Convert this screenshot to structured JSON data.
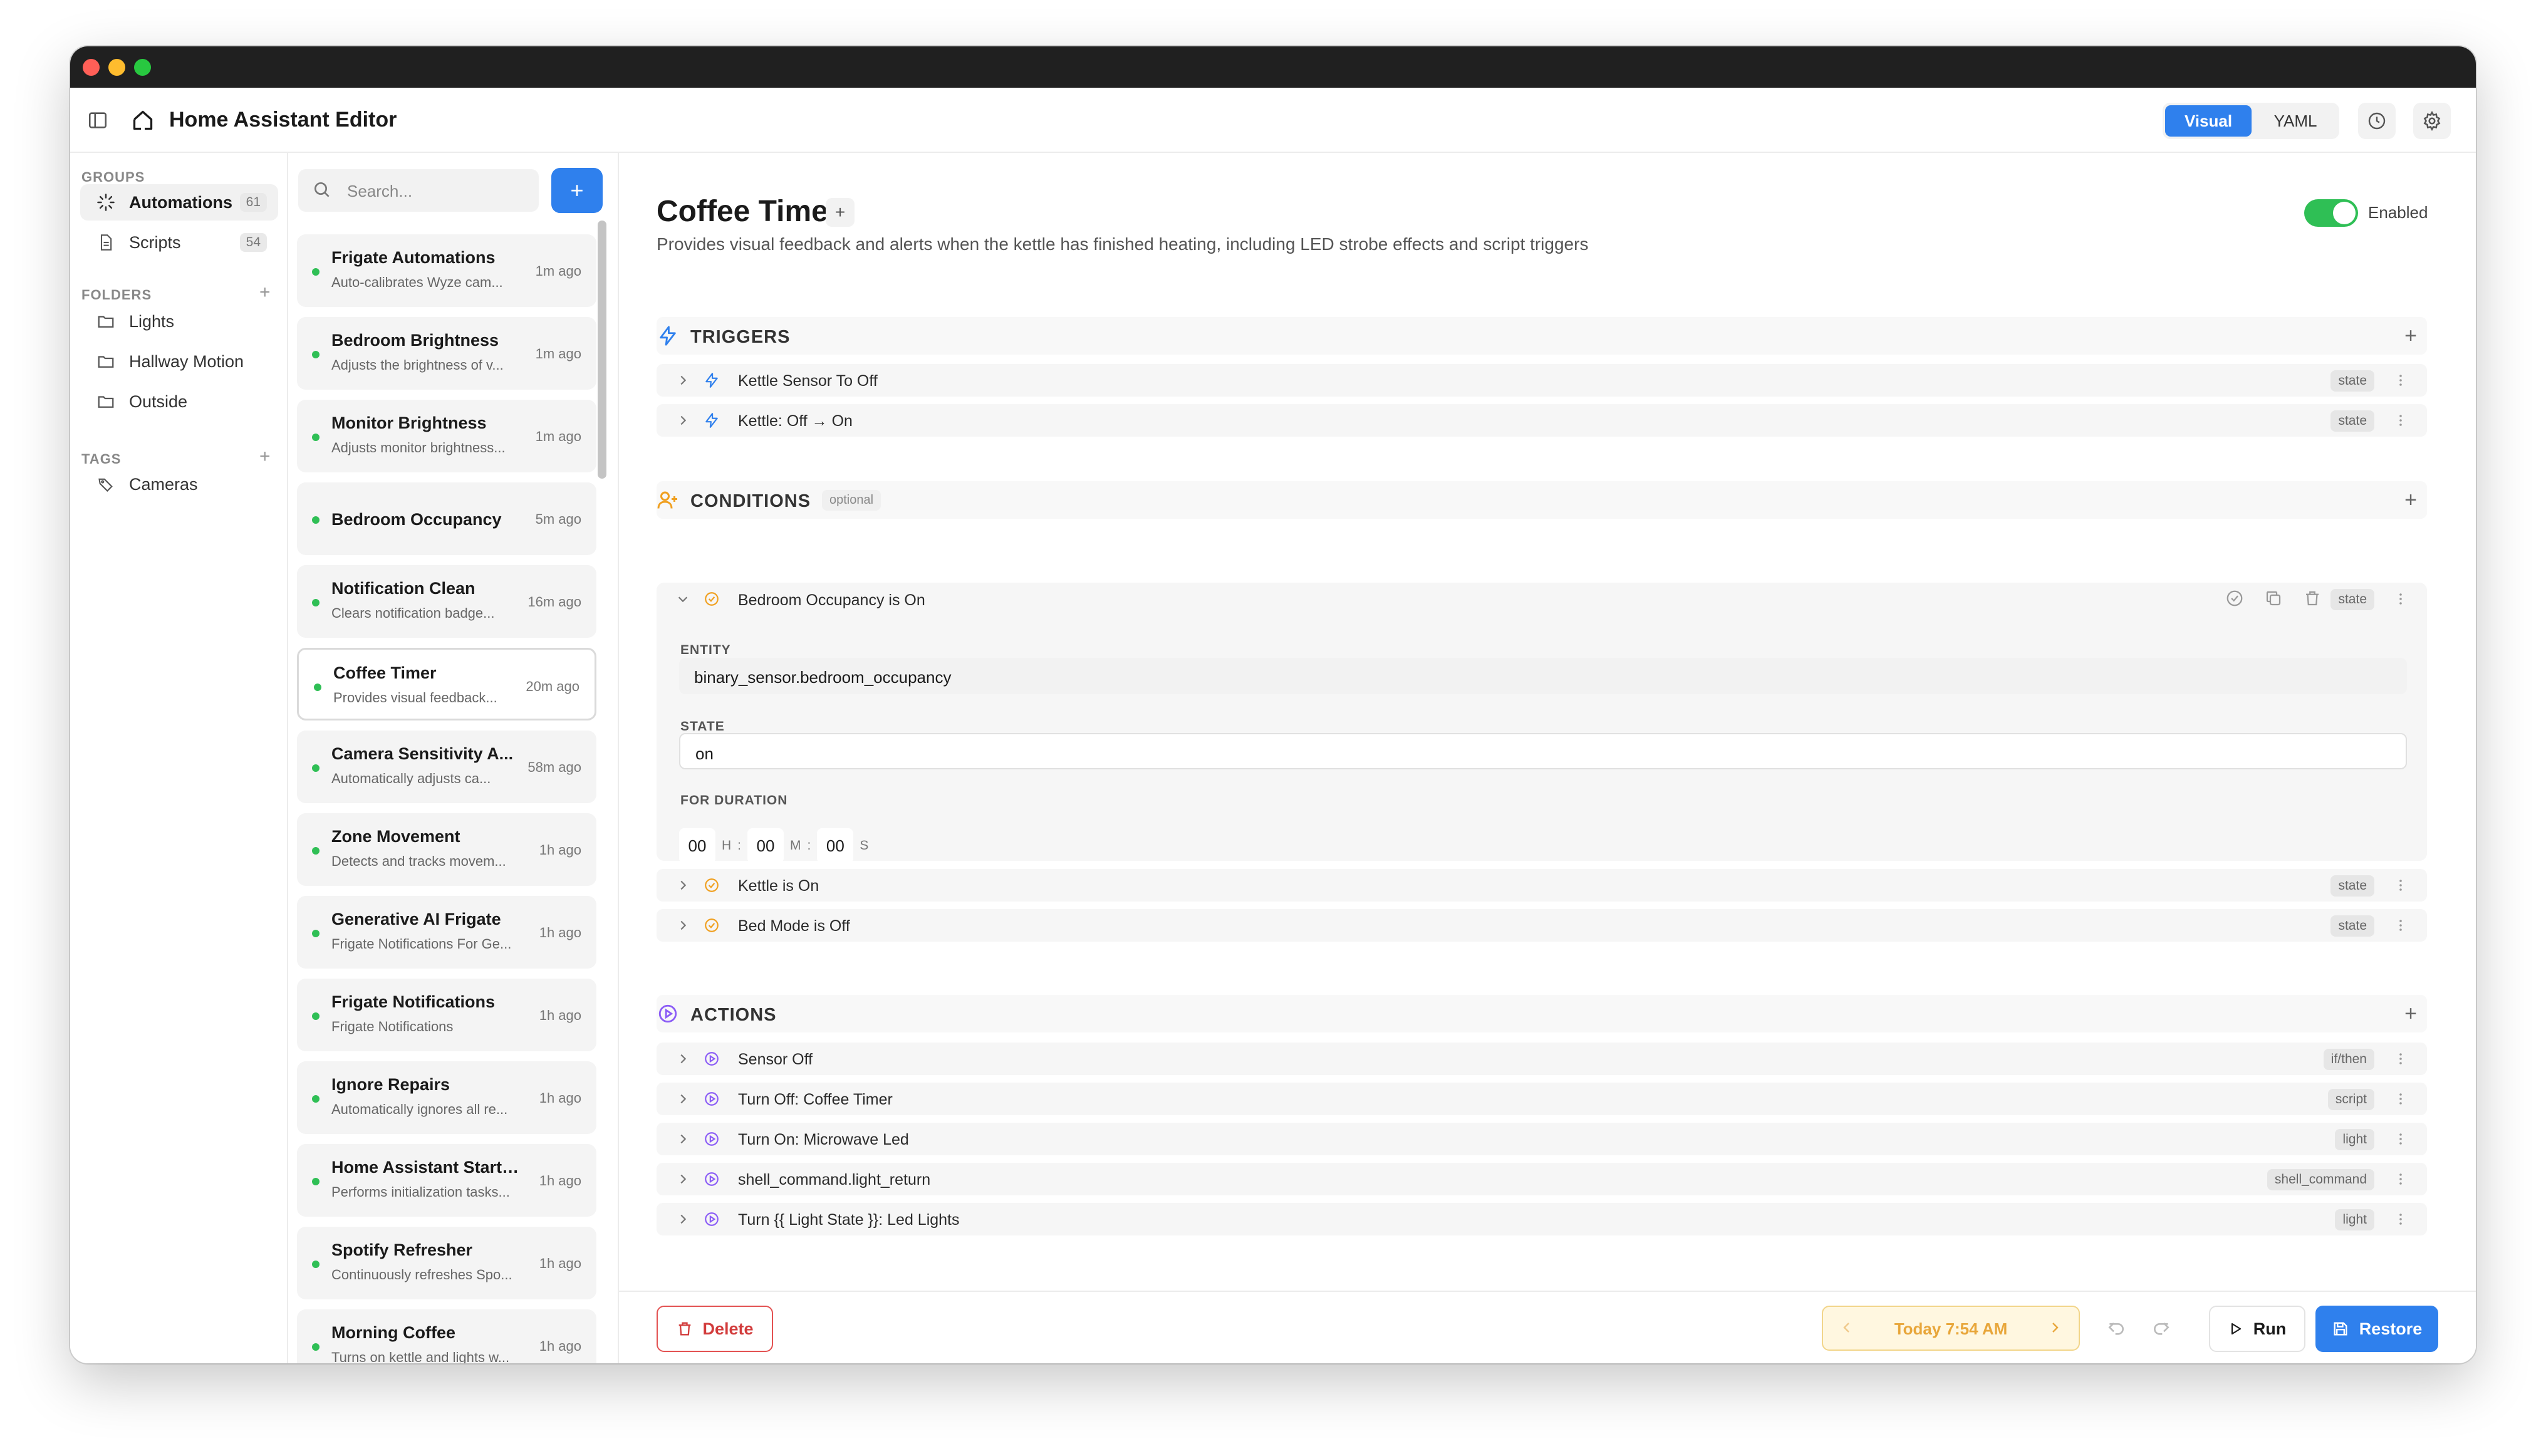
{
  "header": {
    "title": "Home Assistant Editor",
    "visual_label": "Visual",
    "yaml_label": "YAML"
  },
  "sidebar": {
    "groups_label": "GROUPS",
    "groups": [
      {
        "label": "Automations",
        "count": "61"
      },
      {
        "label": "Scripts",
        "count": "54"
      }
    ],
    "folders_label": "FOLDERS",
    "folders": [
      {
        "label": "Lights"
      },
      {
        "label": "Hallway Motion"
      },
      {
        "label": "Outside"
      }
    ],
    "tags_label": "TAGS",
    "tags": [
      {
        "label": "Cameras"
      }
    ]
  },
  "list": {
    "search_placeholder": "Search...",
    "items": [
      {
        "name": "Frigate Automations",
        "desc": "Auto-calibrates Wyze cam...",
        "time": "1m ago"
      },
      {
        "name": "Bedroom Brightness",
        "desc": "Adjusts the brightness of v...",
        "time": "1m ago"
      },
      {
        "name": "Monitor Brightness",
        "desc": "Adjusts monitor brightness...",
        "time": "1m ago"
      },
      {
        "name": "Bedroom Occupancy",
        "desc": "",
        "time": "5m ago"
      },
      {
        "name": "Notification Clean",
        "desc": "Clears notification badge...",
        "time": "16m ago"
      },
      {
        "name": "Coffee Timer",
        "desc": "Provides visual feedback...",
        "time": "20m ago"
      },
      {
        "name": "Camera Sensitivity A...",
        "desc": "Automatically adjusts ca...",
        "time": "58m ago"
      },
      {
        "name": "Zone Movement",
        "desc": "Detects and tracks movem...",
        "time": "1h ago"
      },
      {
        "name": "Generative AI Frigate",
        "desc": "Frigate Notifications For Ge...",
        "time": "1h ago"
      },
      {
        "name": "Frigate Notifications",
        "desc": "Frigate Notifications",
        "time": "1h ago"
      },
      {
        "name": "Ignore Repairs",
        "desc": "Automatically ignores all re...",
        "time": "1h ago"
      },
      {
        "name": "Home Assistant Started!",
        "desc": "Performs initialization tasks...",
        "time": "1h ago"
      },
      {
        "name": "Spotify Refresher",
        "desc": "Continuously refreshes Spo...",
        "time": "1h ago"
      },
      {
        "name": "Morning Coffee",
        "desc": "Turns on kettle and lights w...",
        "time": "1h ago"
      }
    ]
  },
  "editor": {
    "title": "Coffee Timer",
    "description": "Provides visual feedback and alerts when the kettle has finished heating, including LED strobe effects and script triggers",
    "enabled_label": "Enabled",
    "triggers_label": "TRIGGERS",
    "triggers": [
      {
        "label": "Kettle Sensor To Off",
        "badge": "state"
      },
      {
        "label": "Kettle: Off → On",
        "badge": "state"
      }
    ],
    "conditions_label": "CONDITIONS",
    "optional_label": "optional",
    "conditions": [
      {
        "label": "Bedroom Occupancy is On",
        "badge": "state"
      },
      {
        "label": "Kettle is On",
        "badge": "state"
      },
      {
        "label": "Bed Mode is Off",
        "badge": "state"
      }
    ],
    "condition_detail": {
      "entity_label": "ENTITY",
      "entity_value": "binary_sensor.bedroom_occupancy",
      "state_label": "STATE",
      "state_value": "on",
      "duration_label": "FOR DURATION",
      "hours": "00",
      "h_unit": "H",
      "sep1": ":",
      "minutes": "00",
      "m_unit": "M",
      "sep2": ":",
      "seconds": "00",
      "s_unit": "S"
    },
    "actions_label": "ACTIONS",
    "actions": [
      {
        "label": "Sensor Off",
        "badge": "if/then"
      },
      {
        "label": "Turn Off: Coffee Timer",
        "badge": "script"
      },
      {
        "label": "Turn On: Microwave Led",
        "badge": "light"
      },
      {
        "label": "shell_command.light_return",
        "badge": "shell_command"
      },
      {
        "label": "Turn {{ Light State }}: Led Lights",
        "badge": "light"
      }
    ]
  },
  "footer": {
    "delete_label": "Delete",
    "history_label": "Today 7:54 AM",
    "run_label": "Run",
    "restore_label": "Restore"
  },
  "colors": {
    "accent": "#2f80ed",
    "enabled": "#2fbf55",
    "trigger_icon": "#2f80ed",
    "condition_icon": "#f0a020",
    "action_icon": "#8b5cf6",
    "delete": "#d23c3c"
  }
}
